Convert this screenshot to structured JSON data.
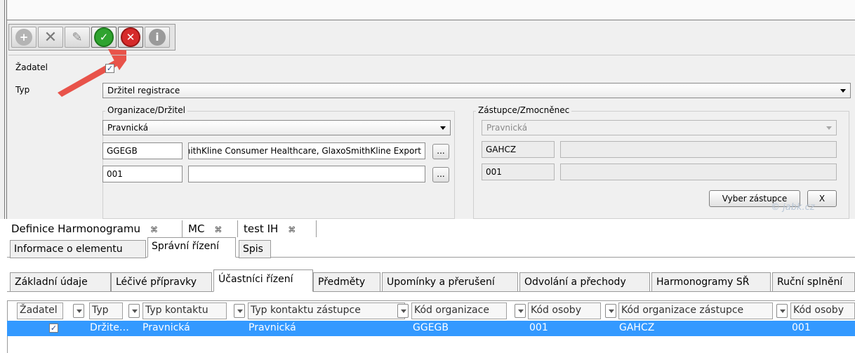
{
  "form": {
    "zadatel_label": "Žadatel",
    "zadatel_checked": true,
    "typ_label": "Typ",
    "typ_value": "Držitel registrace",
    "org_group": {
      "title": "Organizace/Držitel",
      "type_value": "Pravnická",
      "code1": "GGEGB",
      "name1": "SmithKline Consumer Healthcare, GlaxoSmithKline Export",
      "code2": "001",
      "name2": "",
      "browse_label": "..."
    },
    "rep_group": {
      "title": "Zástupce/Zmocněnec",
      "type_value": "Pravnická",
      "code1": "GAHCZ",
      "name1": "",
      "code2": "001",
      "name2": "",
      "select_button": "Vyber zástupce",
      "clear_button": "X",
      "watermark": "© jabk.cz"
    }
  },
  "toolbar": {
    "icons": [
      "add-icon",
      "delete-icon",
      "edit-icon",
      "confirm-icon",
      "cancel-icon",
      "info-icon"
    ]
  },
  "main_tabs": [
    {
      "label": "Definice Harmonogramu",
      "close": "⌘"
    },
    {
      "label": "MC",
      "close": "⌘"
    },
    {
      "label": "test IH",
      "close": "⌘"
    }
  ],
  "sub_tabs": [
    "Informace o elementu",
    "Správní řízení",
    "Spis"
  ],
  "detail_tabs": [
    "Základní údaje",
    "Léčivé přípravky",
    "Účastníci řízení",
    "Předměty",
    "Upomínky a přerušení",
    "Odvolání a přechody",
    "Harmonogramy SŘ",
    "Ruční splnění"
  ],
  "table": {
    "columns": [
      "Žadatel",
      "Typ",
      "Typ kontaktu",
      "Typ kontaktu zástupce",
      "Kód organizace",
      "Kód osoby",
      "Kód organizace zástupce",
      "Kód osoby"
    ],
    "rows": [
      {
        "zadatel": "☑",
        "typ": "Držite…",
        "typ_kontaktu": "Pravnická",
        "typ_kontaktu_zastupce": "Pravnická",
        "kod_organizace": "GGEGB",
        "kod_osoby": "001",
        "kod_organizace_zastupce": "GAHCZ",
        "kod_osoby_zastupce": "001"
      }
    ]
  },
  "colors": {
    "selection": "#3399ff",
    "confirm": "#2fa32f",
    "cancel": "#d62a2a",
    "arrow": "#e8534a"
  }
}
